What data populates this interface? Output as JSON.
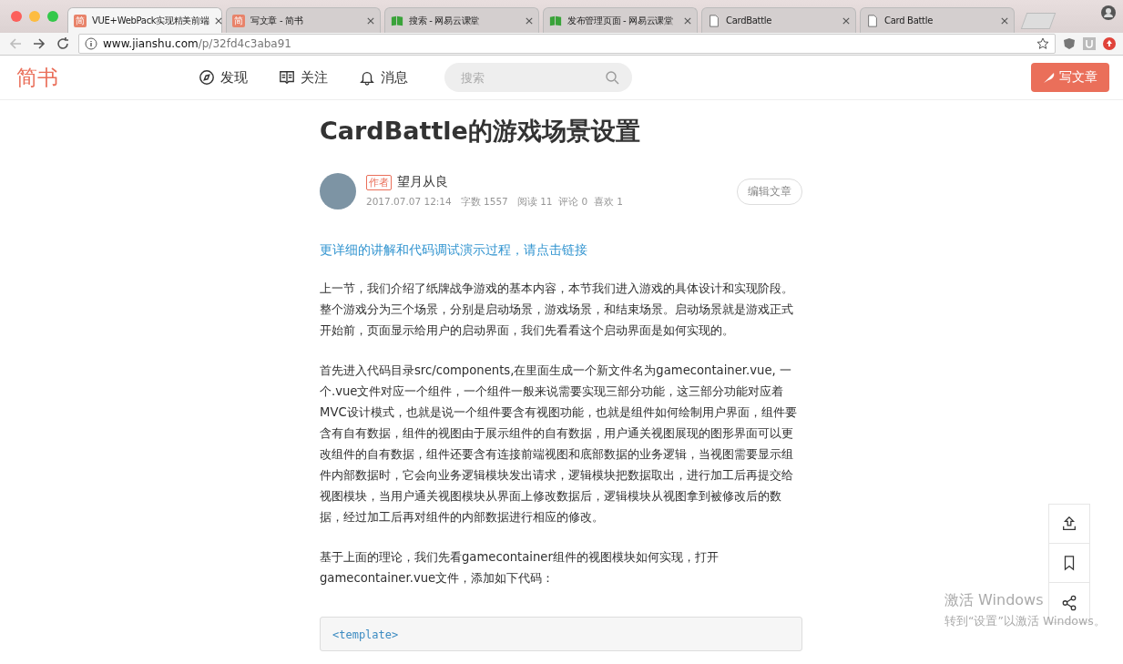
{
  "browser": {
    "tabs": [
      {
        "title": "VUE+WebPack实现精美前端",
        "kind": "badge",
        "icon_char": "简",
        "selected": true
      },
      {
        "title": "写文章 - 简书",
        "kind": "badge",
        "icon_char": "简",
        "selected": false
      },
      {
        "title": "搜索 - 网易云课堂",
        "kind": "book",
        "selected": false
      },
      {
        "title": "发布管理页面 - 网易云课堂",
        "kind": "book",
        "selected": false
      },
      {
        "title": "CardBattle",
        "kind": "page",
        "selected": false
      },
      {
        "title": "Card Battle",
        "kind": "page",
        "selected": false
      }
    ],
    "url_host": "www.jianshu.com",
    "url_path": "/p/32fd4c3aba91"
  },
  "site_header": {
    "logo": "简书",
    "nav": [
      "发现",
      "关注",
      "消息"
    ],
    "search_placeholder": "搜索",
    "write_button": "写文章"
  },
  "article": {
    "title": "CardBattle的游戏场景设置",
    "author_tag": "作者",
    "author": "望月从良",
    "meta": "2017.07.07 12:14   字数 1557   阅读 11  评论 0  喜欢 1",
    "edit_button": "编辑文章",
    "link": "更详细的讲解和代码调试演示过程，请点击链接",
    "paragraphs": [
      "上一节，我们介绍了纸牌战争游戏的基本内容，本节我们进入游戏的具体设计和实现阶段。整个游戏分为三个场景，分别是启动场景，游戏场景，和结束场景。启动场景就是游戏正式开始前，页面显示给用户的启动界面，我们先看看这个启动界面是如何实现的。",
      "首先进入代码目录src/components,在里面生成一个新文件名为gamecontainer.vue, 一个.vue文件对应一个组件，一个组件一般来说需要实现三部分功能，这三部分功能对应着MVC设计模式，也就是说一个组件要含有视图功能，也就是组件如何绘制用户界面，组件要含有自有数据，组件的视图由于展示组件的自有数据，用户通关视图展现的图形界面可以更改组件的自有数据，组件还要含有连接前端视图和底部数据的业务逻辑，当视图需要显示组件内部数据时，它会向业务逻辑模块发出请求，逻辑模块把数据取出，进行加工后再提交给视图模块，当用户通关视图模块从界面上修改数据后，逻辑模块从视图拿到被修改后的数据，经过加工后再对组件的内部数据进行相应的修改。",
      "基于上面的理论，我们先看gamecontainer组件的视图模块如何实现，打开gamecontainer.vue文件，添加如下代码："
    ],
    "code_lines": [
      "<template>"
    ]
  },
  "os_notice": {
    "title": "激活 Windows",
    "text": "转到“设置”以激活 Windows。"
  }
}
